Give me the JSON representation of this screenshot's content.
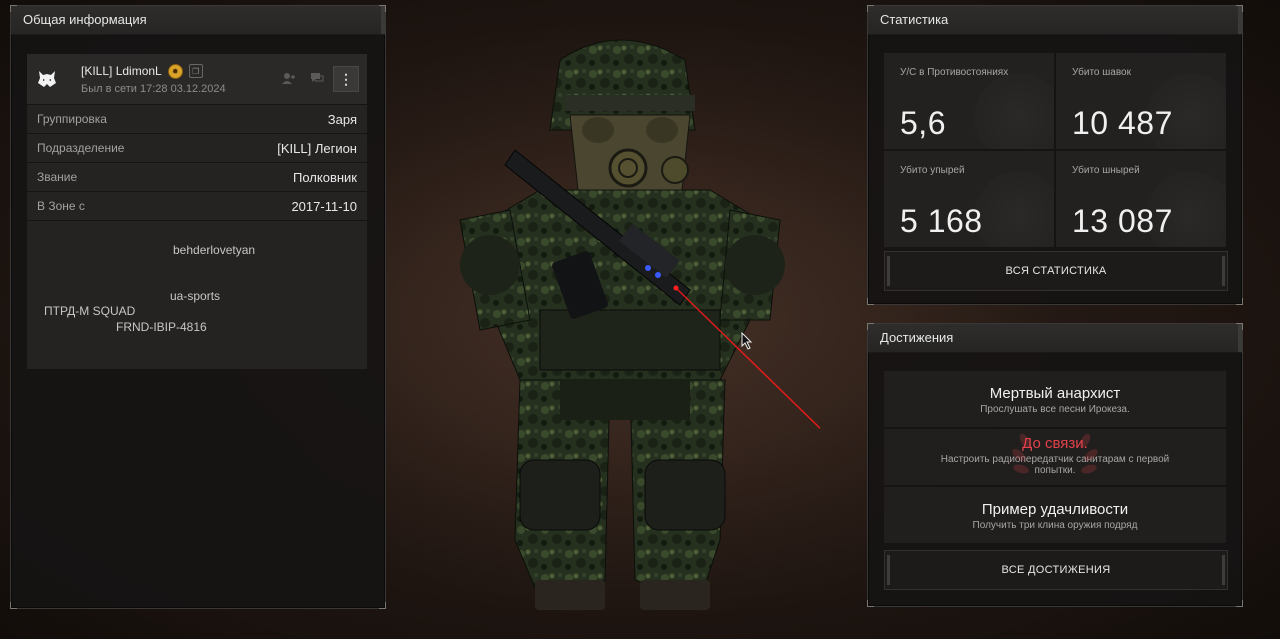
{
  "info_panel": {
    "title": "Общая информация",
    "player": {
      "name": "[KILL] LdimonL",
      "status": "Был в сети 17:28 03.12.2024",
      "avatar_icon": "wolf-head-icon",
      "clan_badge_icon": "sun-badge-icon",
      "copy_icon": "copy-icon",
      "actions": [
        "add-friend-icon",
        "chat-icon",
        "more-vertical-icon"
      ]
    },
    "rows": [
      {
        "label": "Группировка",
        "value": "Заря"
      },
      {
        "label": "Подразделение",
        "value": "[KILL] Легион"
      },
      {
        "label": "Звание",
        "value": "Полковник"
      },
      {
        "label": "В Зоне с",
        "value": "2017-11-10"
      }
    ],
    "description_lines": [
      "behderlovetyan",
      "ua-sports",
      "ПТРД-М SQUAD",
      "FRND-IBIP-4816"
    ]
  },
  "stats_panel": {
    "title": "Статистика",
    "stats": [
      {
        "label": "У/С в Противостояниях",
        "value": "5,6"
      },
      {
        "label": "Убито шавок",
        "value": "10 487"
      },
      {
        "label": "Убито упырей",
        "value": "5 168"
      },
      {
        "label": "Убито шнырей",
        "value": "13 087"
      }
    ],
    "all_stats_button": "ВСЯ СТАТИСТИКА"
  },
  "achievements_panel": {
    "title": "Достижения",
    "items": [
      {
        "title": "Мертвый анархист",
        "description": "Прослушать все песни Ирокеза."
      },
      {
        "title": "До связи.",
        "description": "Настроить радиопередатчик санитарам с первой попытки.",
        "color": "#e2414a"
      },
      {
        "title": "Пример удачливости",
        "description": "Получить три клина оружия подряд"
      }
    ],
    "all_achievements_button": "ВСЕ ДОСТИЖЕНИЯ"
  },
  "colors": {
    "accent_red": "#e2414a",
    "laser": "#ff1a1a",
    "panel_bg": "#161413"
  }
}
